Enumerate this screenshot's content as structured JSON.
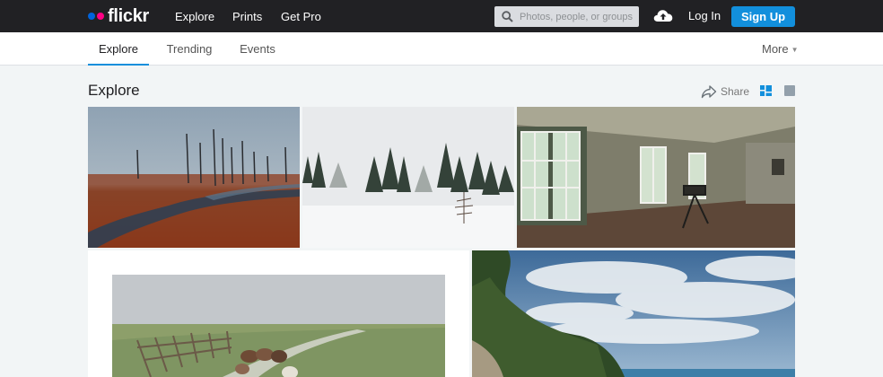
{
  "header": {
    "logo_text": "flickr",
    "nav": [
      {
        "label": "Explore"
      },
      {
        "label": "Prints"
      },
      {
        "label": "Get Pro"
      }
    ],
    "search_placeholder": "Photos, people, or groups",
    "login_label": "Log In",
    "signup_label": "Sign Up"
  },
  "subnav": {
    "tabs": [
      {
        "label": "Explore",
        "active": true
      },
      {
        "label": "Trending",
        "active": false
      },
      {
        "label": "Events",
        "active": false
      }
    ],
    "more_label": "More"
  },
  "page": {
    "title": "Explore",
    "share_label": "Share"
  },
  "colors": {
    "accent": "#128fdc",
    "topbar": "#212124",
    "logo_blue": "#0063dc",
    "logo_pink": "#ff0084"
  },
  "icons": [
    "search-icon",
    "cloud-upload-icon",
    "share-icon",
    "justified-view-icon",
    "single-view-icon",
    "caret-down-icon"
  ]
}
